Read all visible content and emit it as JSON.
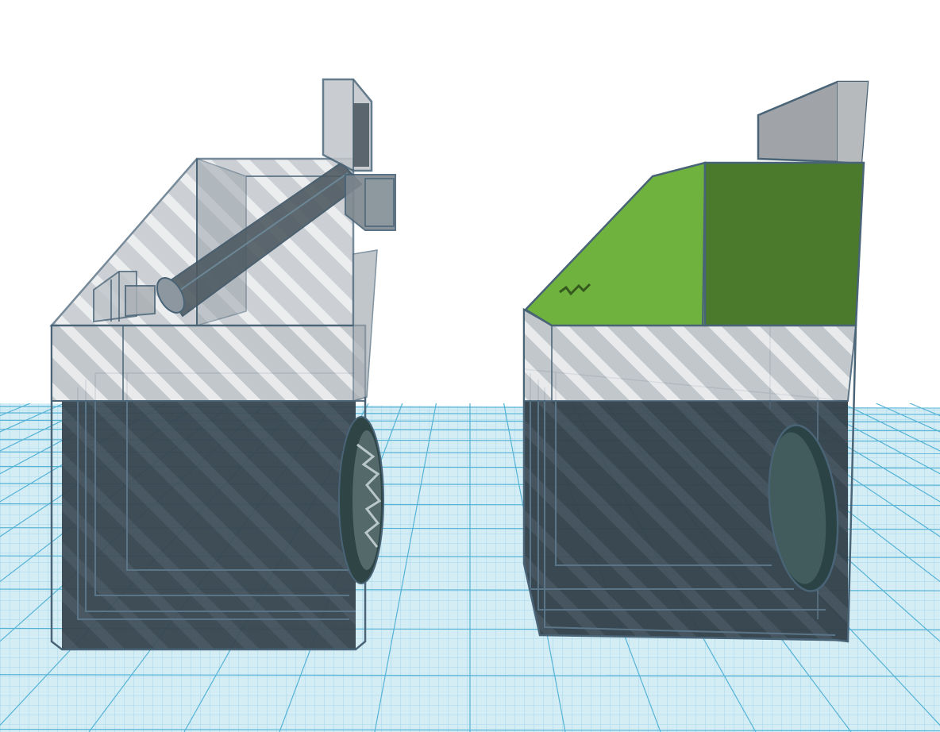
{
  "app": {
    "name": "",
    "view": "3d-workplane"
  },
  "colors": {
    "background": "#ffffff",
    "workplane": "#cfe8f0",
    "grid_minor": "#9fd3e6",
    "grid_major": "#4fb0d4",
    "hole_fill": "#b9bec4",
    "hole_stripe": "#e9ebed",
    "hole_edge": "#4c6478",
    "dark_interior": "#2d3a43",
    "green_light": "#6fb23d",
    "green_dark": "#4a7a2c",
    "wheel": "#2e4a4b"
  },
  "scene": {
    "objects": [
      {
        "id": "left-assembly",
        "type": "transparent-holes-group",
        "parts": [
          "base-box",
          "sloped-top",
          "vertical-post",
          "diagonal-tube",
          "small-brackets",
          "side-wheel"
        ]
      },
      {
        "id": "right-assembly",
        "type": "mixed-solid-and-holes-group",
        "parts": [
          "base-box",
          "green-sloped-top",
          "green-top-block",
          "gray-back-panel",
          "side-wheel"
        ]
      }
    ]
  }
}
